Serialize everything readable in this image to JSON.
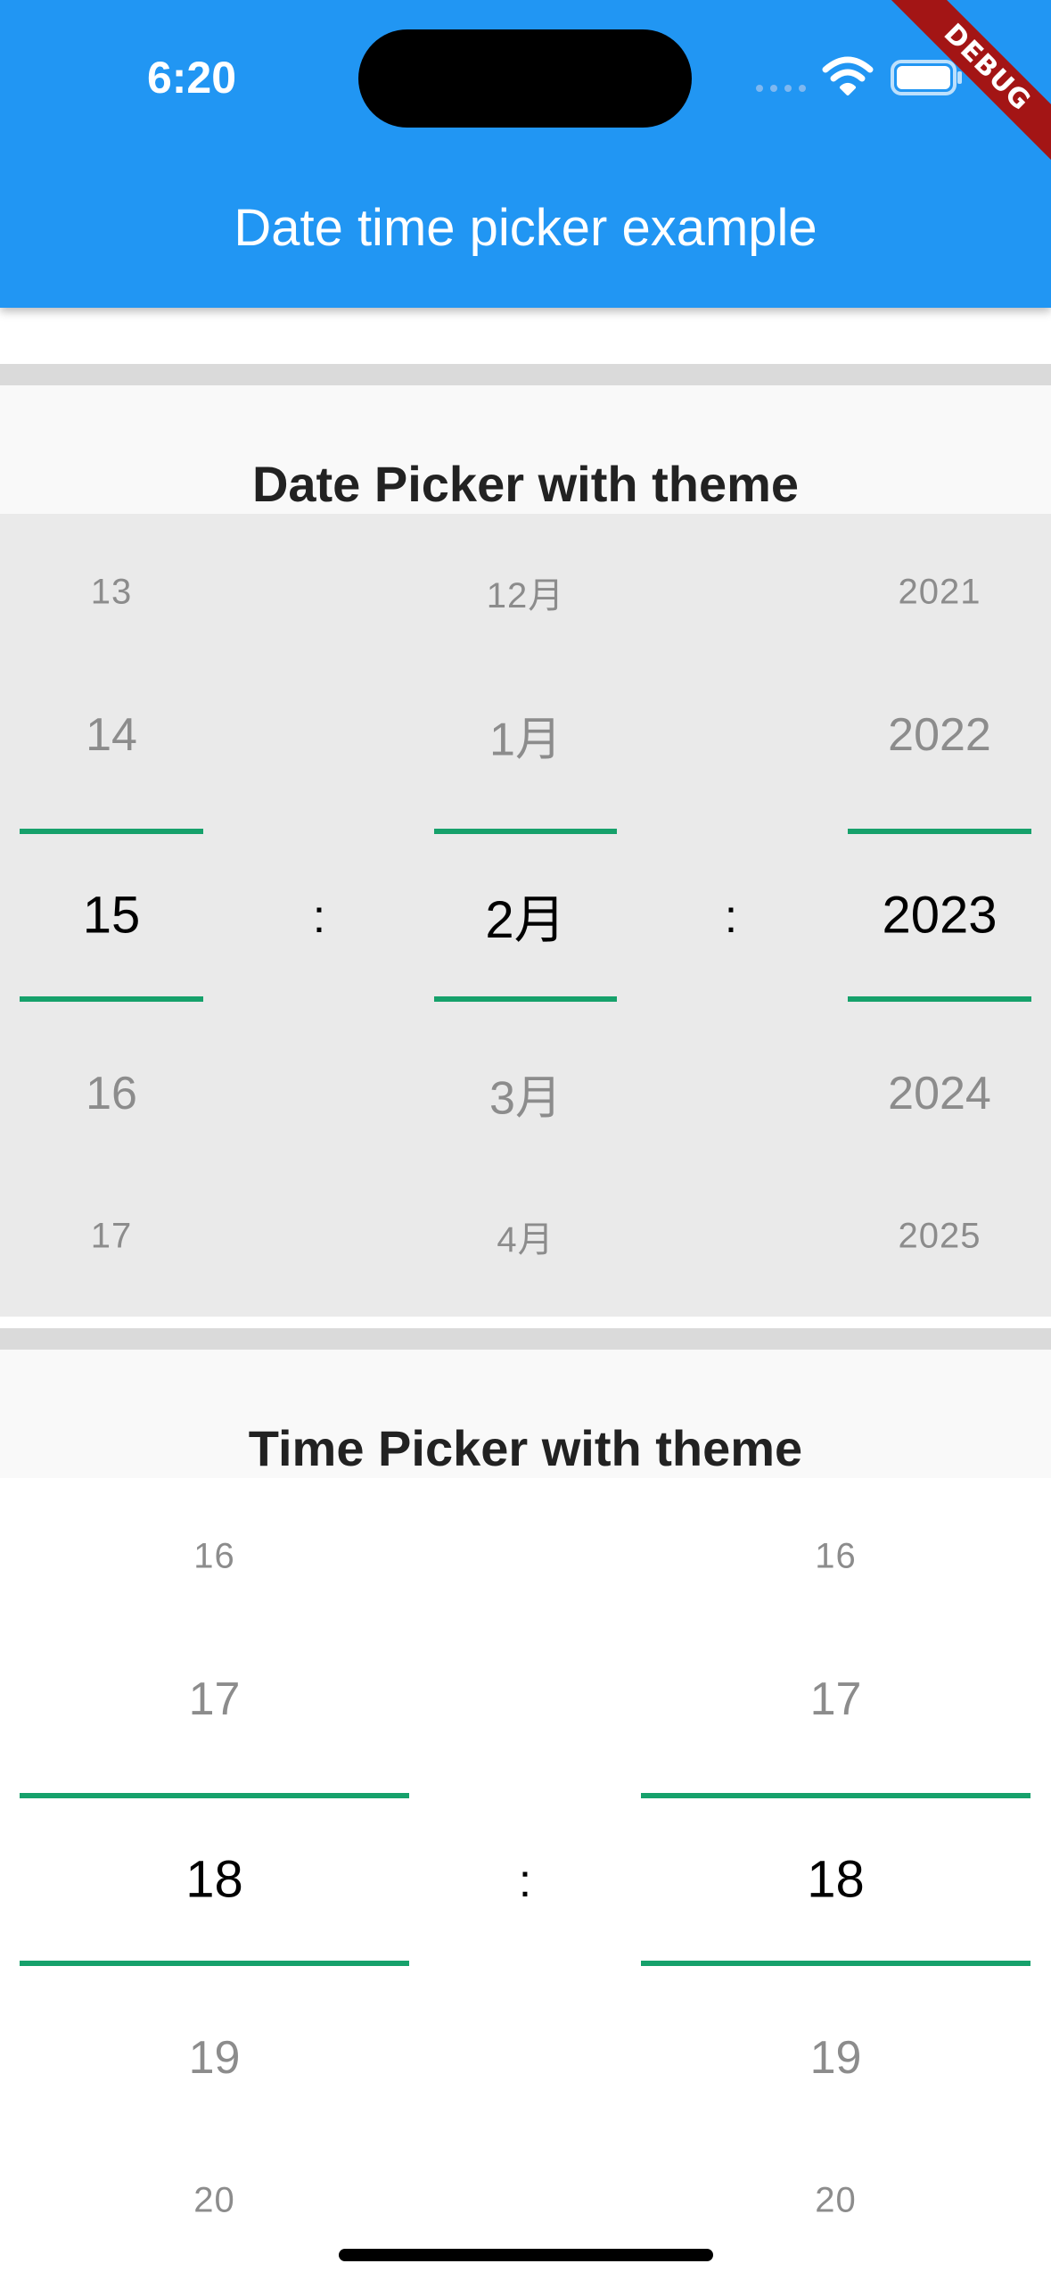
{
  "status_bar": {
    "time": "6:20"
  },
  "app_bar": {
    "title": "Date time picker example",
    "color": "#2196f3",
    "debug_banner": "DEBUG"
  },
  "date_picker": {
    "title": "Date Picker with theme",
    "separator": ":",
    "columns": [
      {
        "name": "day",
        "items": [
          "13",
          "14",
          "15",
          "16",
          "17"
        ],
        "selected": "15"
      },
      {
        "name": "month",
        "items": [
          "12月",
          "1月",
          "2月",
          "3月",
          "4月"
        ],
        "selected": "2月"
      },
      {
        "name": "year",
        "items": [
          "2021",
          "2022",
          "2023",
          "2024",
          "2025"
        ],
        "selected": "2023"
      }
    ]
  },
  "time_picker": {
    "title": "Time Picker with theme",
    "separator": ":",
    "columns": [
      {
        "name": "hour",
        "items": [
          "16",
          "17",
          "18",
          "19",
          "20"
        ],
        "selected": "18"
      },
      {
        "name": "minute",
        "items": [
          "16",
          "17",
          "18",
          "19",
          "20"
        ],
        "selected": "18"
      }
    ]
  },
  "theme": {
    "selection_line_color": "#16a16b",
    "date_picker_background": "#eaeaea",
    "time_picker_background": "#ffffff"
  },
  "icons": {
    "signal": "cellular-signal-icon",
    "wifi": "wifi-icon",
    "battery": "battery-icon"
  }
}
